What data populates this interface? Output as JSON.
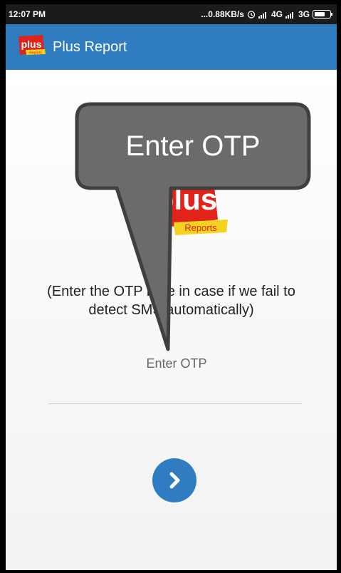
{
  "status_bar": {
    "time": "12:07 PM",
    "indicators": "...0.88KB/s",
    "signal_1": "4G",
    "signal_2": "3G"
  },
  "app_bar": {
    "logo_text": "plus",
    "logo_sub": "Reports",
    "title": "Plus Report"
  },
  "main": {
    "logo_text": "plus",
    "logo_sub": "Reports",
    "helper_line1": "(Enter the OTP here in case if we fail to",
    "helper_line2": "detect SMS automatically)",
    "otp_placeholder": "Enter OTP"
  },
  "tooltip": {
    "text": "Enter OTP"
  },
  "colors": {
    "app_bar": "#2f7dc0",
    "accent": "#2f7dc0",
    "logo_red": "#e2231a",
    "logo_yellow": "#f4d21f",
    "tooltip_fill": "#6b6b6b"
  },
  "icons": {
    "next_button": "chevron-right-icon",
    "battery": "battery-icon",
    "alarm": "alarm-icon",
    "signal": "signal-icon"
  }
}
